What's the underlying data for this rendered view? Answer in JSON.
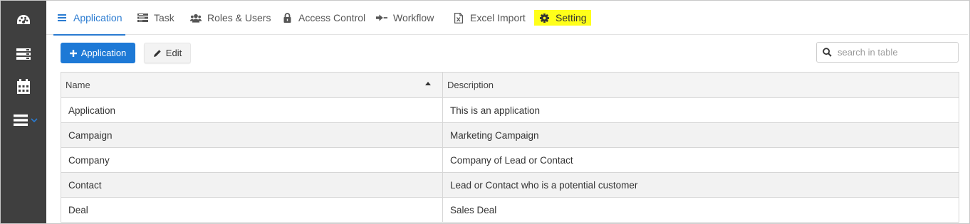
{
  "sidebar": {
    "items": [
      {
        "icon": "dashboard-icon"
      },
      {
        "icon": "server-icon"
      },
      {
        "icon": "calendar-icon"
      },
      {
        "icon": "menu-icon"
      }
    ]
  },
  "tabs": [
    {
      "label": "Application",
      "icon": "list-icon",
      "active": true
    },
    {
      "label": "Task",
      "icon": "tasks-icon"
    },
    {
      "label": "Roles & Users",
      "icon": "users-icon"
    },
    {
      "label": "Access Control",
      "icon": "lock-icon"
    },
    {
      "label": "Workflow",
      "icon": "workflow-icon"
    },
    {
      "label": "Excel Import",
      "icon": "excel-file-icon"
    },
    {
      "label": "Setting",
      "icon": "gear-icon",
      "highlighted": true
    }
  ],
  "toolbar": {
    "add_label": "Application",
    "edit_label": "Edit"
  },
  "search": {
    "placeholder": "search in table",
    "value": ""
  },
  "table": {
    "columns": [
      "Name",
      "Description"
    ],
    "sort": {
      "column": "Name",
      "direction": "ascending"
    },
    "rows": [
      [
        "Application",
        "This is an application"
      ],
      [
        "Campaign",
        "Marketing Campaign"
      ],
      [
        "Company",
        "Company of Lead or Contact"
      ],
      [
        "Contact",
        "Lead or Contact who is a potential customer"
      ],
      [
        "Deal",
        "Sales Deal"
      ]
    ]
  },
  "colors": {
    "accent": "#2a7bd1",
    "primary_button": "#1d79d6",
    "sidebar_bg": "#3f3f3f",
    "highlight": "#ffff1a"
  }
}
